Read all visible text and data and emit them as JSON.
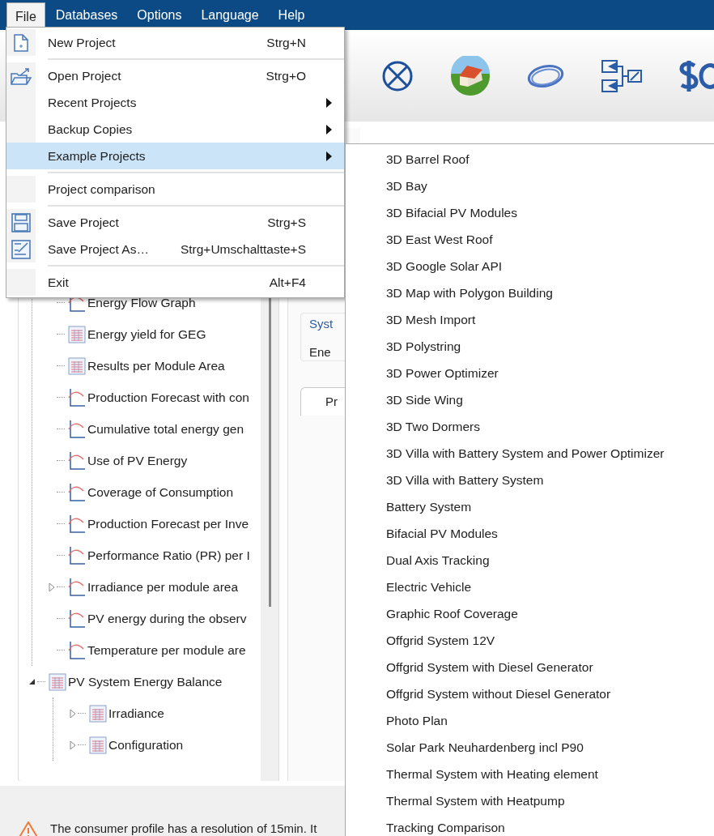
{
  "menubar": [
    {
      "label": "File",
      "selected": true
    },
    {
      "label": "Databases",
      "selected": false
    },
    {
      "label": "Options",
      "selected": false
    },
    {
      "label": "Language",
      "selected": false
    },
    {
      "label": "Help",
      "selected": false
    }
  ],
  "file_menu": {
    "groups": [
      [
        {
          "label": "New Project",
          "shortcut": "Strg+N",
          "submenu": false,
          "selected": false
        }
      ],
      [
        {
          "label": "Open Project",
          "shortcut": "Strg+O",
          "submenu": false,
          "selected": false
        },
        {
          "label": "Recent Projects",
          "submenu": true,
          "selected": false
        },
        {
          "label": "Backup Copies",
          "submenu": true,
          "selected": false
        },
        {
          "label": "Example Projects",
          "submenu": true,
          "selected": true
        }
      ],
      [
        {
          "label": "Project comparison",
          "submenu": false,
          "selected": false
        }
      ],
      [
        {
          "label": "Save Project",
          "shortcut": "Strg+S",
          "submenu": false,
          "selected": false
        },
        {
          "label": "Save Project As…",
          "shortcut": "Strg+Umschalttaste+S",
          "submenu": false,
          "selected": false
        }
      ],
      [
        {
          "label": "Exit",
          "shortcut": "Alt+F4",
          "submenu": false,
          "selected": false
        }
      ]
    ]
  },
  "example_projects": [
    "3D Barrel Roof",
    "3D Bay",
    "3D Bifacial PV Modules",
    "3D East West Roof",
    "3D Google Solar API",
    "3D Map with Polygon Building",
    "3D Mesh Import",
    "3D Polystring",
    "3D Power Optimizer",
    "3D Side Wing",
    "3D Two Dormers",
    "3D Villa with Battery System and Power Optimizer",
    "3D Villa with Battery System",
    "Battery System",
    "Bifacial PV Modules",
    "Dual Axis Tracking",
    "Electric Vehicle",
    "Graphic Roof Coverage",
    "Offgrid System 12V",
    "Offgrid System with Diesel Generator",
    "Offgrid System without Diesel Generator",
    "Photo Plan",
    "Solar Park Neuhardenberg incl P90",
    "Thermal System with Heating element",
    "Thermal System with Heatpump",
    "Tracking Comparison"
  ],
  "tree": {
    "continued_children": [
      {
        "label": "Energy Flow Graph",
        "kind": "chart"
      },
      {
        "label": "Energy yield for GEG",
        "kind": "table"
      },
      {
        "label": "Results per Module Area",
        "kind": "table"
      },
      {
        "label": "Production Forecast with con",
        "kind": "chart"
      },
      {
        "label": "Cumulative total energy gen",
        "kind": "chart"
      },
      {
        "label": "Use of PV Energy",
        "kind": "chart"
      },
      {
        "label": "Coverage of Consumption",
        "kind": "chart"
      },
      {
        "label": "Production Forecast per Inve",
        "kind": "chart"
      },
      {
        "label": "Performance Ratio (PR) per I",
        "kind": "chart"
      },
      {
        "label": "Irradiance per module area",
        "kind": "chart",
        "expanded": false
      },
      {
        "label": "PV energy during the observ",
        "kind": "chart"
      },
      {
        "label": "Temperature per module are",
        "kind": "chart"
      }
    ],
    "nodes": [
      {
        "label": "PV System Energy Balance",
        "kind": "table",
        "expanded": true,
        "children": [
          {
            "label": "Irradiance",
            "kind": "table",
            "expanded": false
          },
          {
            "label": "Configuration",
            "kind": "table",
            "expanded": false
          }
        ]
      }
    ]
  },
  "side_panel": {
    "group_title": "Syst",
    "field_value": "Ene",
    "tab_label": "Pr"
  },
  "warning": "The consumer profile has a resolution of 15min. It"
}
